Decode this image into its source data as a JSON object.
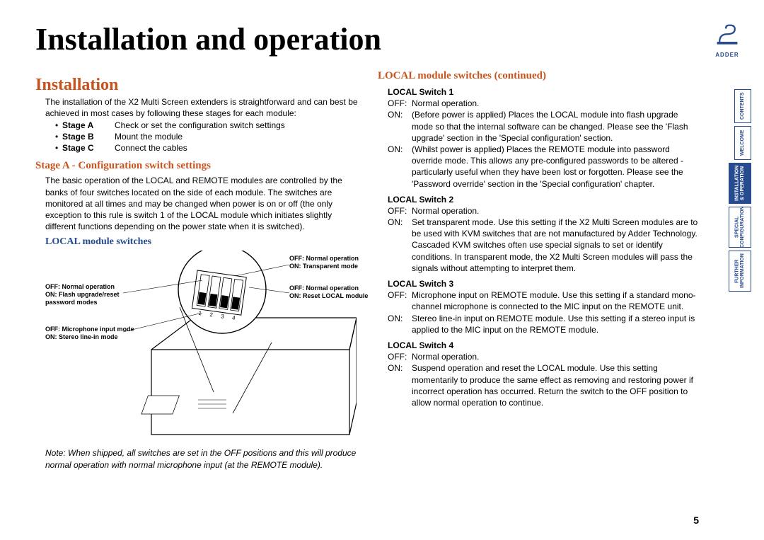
{
  "logoText": "ADDER",
  "mainTitle": "Installation and operation",
  "installation": {
    "title": "Installation",
    "intro": "The installation of the X2 Multi Screen extenders is straightforward and can best be achieved in most cases by following these stages for each module:",
    "stages": [
      {
        "label": "Stage A",
        "text": "Check or set the configuration switch settings"
      },
      {
        "label": "Stage B",
        "text": "Mount the module"
      },
      {
        "label": "Stage C",
        "text": "Connect the cables"
      }
    ]
  },
  "stageA": {
    "title": "Stage A - Configuration switch settings",
    "text": "The basic operation of the LOCAL and REMOTE modules are controlled by the banks of four switches located on the side of each module. The switches are monitored at all times and may be changed when power is on or off (the only exception to this rule is switch 1 of the LOCAL module which initiates slightly different functions depending on the power state when it is switched)."
  },
  "localSwitches": {
    "title": "LOCAL module switches",
    "diagramLabels": {
      "sw1": {
        "off": "OFF: Normal operation",
        "on": "ON: Flash upgrade/reset password modes"
      },
      "sw2": {
        "off": "OFF: Normal operation",
        "on": "ON: Transparent mode"
      },
      "sw3": {
        "off": "OFF: Microphone input mode",
        "on": "ON: Stereo line-in mode"
      },
      "sw4": {
        "off": "OFF: Normal operation",
        "on": "ON: Reset LOCAL module"
      }
    },
    "note": "Note: When shipped, all switches are set in the OFF positions and this will produce normal operation with normal microphone input (at the REMOTE module)."
  },
  "localContinued": {
    "title": "LOCAL module switches (continued)",
    "switches": [
      {
        "head": "LOCAL Switch 1",
        "off": "Normal operation.",
        "on1": "(Before power is applied) Places the LOCAL module into flash upgrade mode so that the internal software can be changed. Please see the 'Flash upgrade' section in the 'Special configuration' section.",
        "on2": "(Whilst power is applied) Places the REMOTE module into password override mode. This allows any pre-configured passwords to be altered - particularly useful when they have been lost or forgotten. Please see the 'Password override' section in the 'Special configuration' chapter."
      },
      {
        "head": "LOCAL Switch 2",
        "off": "Normal operation.",
        "on1": "Set transparent mode. Use this setting if the X2 Multi Screen modules are to be used with KVM switches that are not manufactured by Adder Technology. Cascaded KVM switches often use special signals to set or identify conditions. In transparent mode, the X2 Multi Screen modules will pass the signals without attempting to interpret them."
      },
      {
        "head": "LOCAL Switch 3",
        "off": "Microphone input on REMOTE module. Use this setting if a standard mono-channel microphone is connected to the MIC input on the REMOTE unit.",
        "on1": "Stereo line-in input on REMOTE module. Use this setting if a stereo input is applied to the MIC input on the REMOTE module."
      },
      {
        "head": "LOCAL Switch 4",
        "off": "Normal operation.",
        "on1": "Suspend operation and reset the LOCAL module. Use this setting momentarily to produce the same effect as removing and restoring power if incorrect operation has occurred. Return the switch to the OFF position to allow normal operation to continue."
      }
    ]
  },
  "nav": {
    "items": [
      {
        "label": "CONTENTS"
      },
      {
        "label": "WELCOME"
      },
      {
        "label": "INSTALLATION & OPERATION",
        "active": true
      },
      {
        "label": "SPECIAL CONFIGURATION"
      },
      {
        "label": "FURTHER INFORMATION"
      }
    ]
  },
  "pageNumber": "5"
}
